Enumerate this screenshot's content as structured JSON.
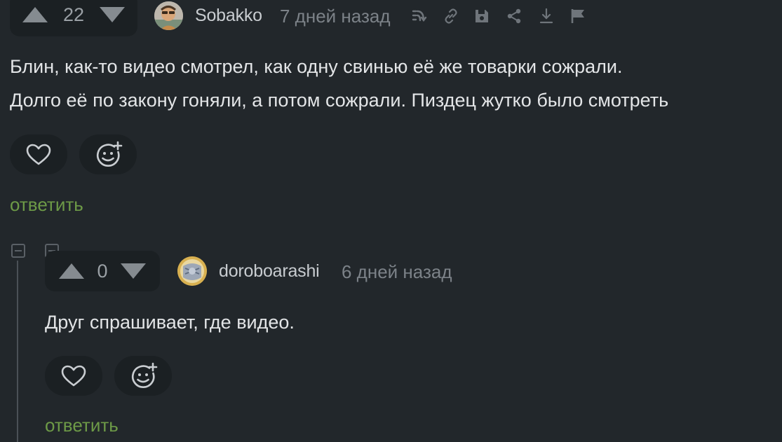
{
  "comments": [
    {
      "rating": "22",
      "username": "Sobakko",
      "date": "7 дней назад",
      "text_lines": [
        "Блин, как-то видео смотрел, как одну свинью её же товарки сожрали.",
        "Долго её по закону гоняли, а потом сожрали. Пиздец жутко было смотреть"
      ],
      "reply_label": "ответить",
      "toolbar_icons": [
        "branch-icon",
        "link-icon",
        "save-icon",
        "share-icon",
        "download-icon",
        "flag-icon"
      ]
    },
    {
      "rating": "0",
      "username": "doroboarashi",
      "date": "6 дней назад",
      "text_lines": [
        "Друг спрашивает, где видео."
      ],
      "reply_label": "ответить"
    }
  ],
  "colors": {
    "background": "#22272b",
    "pill": "#1b2023",
    "reply_link": "#6d9a47",
    "muted": "#7c8288"
  }
}
